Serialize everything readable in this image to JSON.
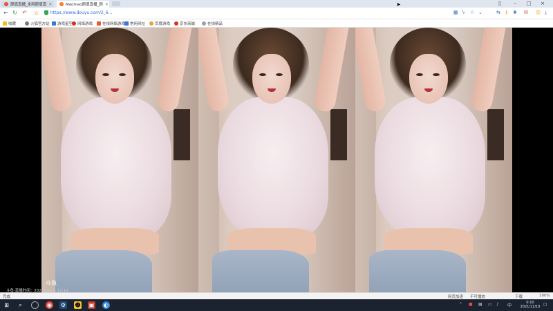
{
  "browser": {
    "tabs": [
      {
        "label": "颜值直播_全网颜值直",
        "active": false
      },
      {
        "label": "Maomao颜值直播_颜",
        "active": true
      }
    ],
    "url": "https://www.douyu.com/2_6...",
    "bookmarks": [
      "收藏",
      "火狐官方站",
      "游戏星空",
      "网络游戏",
      "在线网络游戏",
      "常用网址",
      "百度游戏",
      "京东商城",
      "在线精品"
    ]
  },
  "video": {
    "watermark_text": "斗鱼·直播时间：2021/11/11 11:10",
    "logo_text": "斗鱼"
  },
  "statusbar": {
    "left_text": "完成",
    "right_items": [
      "网页加速",
      "不可播放",
      "下载",
      "100%"
    ]
  },
  "taskbar": {
    "clock_time": "0:10",
    "clock_date": "2021/11/10",
    "tray_lang": "中"
  },
  "colors": {
    "taskbar_bg": "#1b2330",
    "tabbar_bg": "#dfe6ef",
    "accent": "#2b6bd6"
  }
}
